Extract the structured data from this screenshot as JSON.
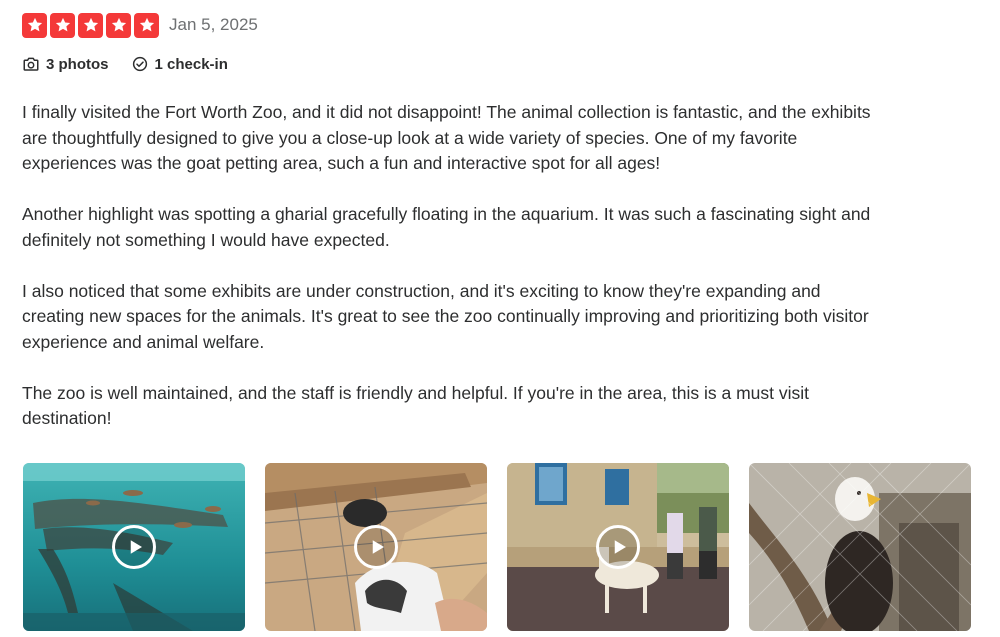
{
  "review": {
    "star_count": 5,
    "date": "Jan 5, 2025",
    "photos_label": "3 photos",
    "checkin_label": "1 check-in",
    "paragraphs": [
      "I finally visited the Fort Worth Zoo, and it did not disappoint! The animal collection is fantastic, and the exhibits are thoughtfully designed to give you a close-up look at a wide variety of species. One of my favorite experiences was the goat petting area, such a fun and interactive spot for all ages!",
      "Another highlight was spotting a gharial gracefully floating in the aquarium. It was such a fascinating sight and definitely not something I would have expected.",
      "I also noticed that some exhibits are under construction, and it's exciting to know they're expanding and creating new spaces for the animals. It's great to see the zoo continually improving and prioritizing both visitor experience and animal welfare.",
      "The zoo is well maintained, and the staff is friendly and helpful. If you're in the area, this is a must visit destination!"
    ]
  },
  "media": [
    {
      "kind": "video",
      "icon": "play-icon"
    },
    {
      "kind": "video",
      "icon": "play-icon"
    },
    {
      "kind": "video",
      "icon": "play-icon"
    },
    {
      "kind": "photo"
    }
  ],
  "colors": {
    "star_red": "#f43939",
    "text": "#2d2e2f",
    "muted": "#6e7072"
  },
  "icons": {
    "star": "star-icon",
    "camera": "camera-icon",
    "checkin": "checkin-icon",
    "play": "play-icon"
  }
}
